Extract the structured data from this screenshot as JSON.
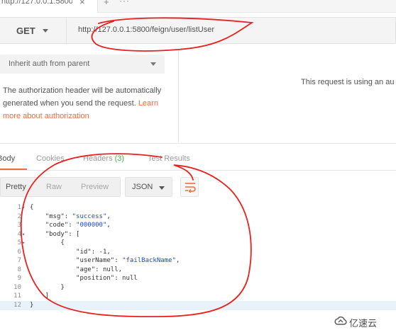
{
  "tab": {
    "title": "http://127.0.0.1:5800/",
    "close": "×",
    "add": "+",
    "more": "···"
  },
  "request": {
    "method": "GET",
    "url": "http://127.0.0.1:5800/feign/user/listUser"
  },
  "auth": {
    "type_selected": "Inherit auth from parent",
    "description": "The authorization header will be automatically generated when you send the request.",
    "link_text": "Learn more about authorization",
    "note": "This request is using an au"
  },
  "response_tabs": [
    {
      "label": "Body",
      "active": true
    },
    {
      "label": "Cookies"
    },
    {
      "label": "Headers",
      "count": "(3)"
    },
    {
      "label": "Test Results"
    }
  ],
  "body_toolbar": {
    "pretty": "Pretty",
    "raw": "Raw",
    "preview": "Preview",
    "language": "JSON"
  },
  "code_lines": [
    {
      "n": "1",
      "fold": true,
      "parts": [
        [
          "p",
          "{"
        ]
      ]
    },
    {
      "n": "2",
      "parts": [
        [
          "p",
          "    "
        ],
        [
          "k",
          "\"msg\""
        ],
        [
          "p",
          ": "
        ],
        [
          "s",
          "\"success\""
        ],
        [
          "p",
          ","
        ]
      ]
    },
    {
      "n": "3",
      "parts": [
        [
          "p",
          "    "
        ],
        [
          "k",
          "\"code\""
        ],
        [
          "p",
          ": "
        ],
        [
          "s",
          "\"000000\""
        ],
        [
          "p",
          ","
        ]
      ]
    },
    {
      "n": "4",
      "fold": true,
      "parts": [
        [
          "p",
          "    "
        ],
        [
          "k",
          "\"body\""
        ],
        [
          "p",
          ": ["
        ]
      ]
    },
    {
      "n": "5",
      "fold": true,
      "parts": [
        [
          "p",
          "        {"
        ]
      ]
    },
    {
      "n": "6",
      "parts": [
        [
          "p",
          "            "
        ],
        [
          "k",
          "\"id\""
        ],
        [
          "p",
          ": -1,"
        ]
      ]
    },
    {
      "n": "7",
      "parts": [
        [
          "p",
          "            "
        ],
        [
          "k",
          "\"userName\""
        ],
        [
          "p",
          ": "
        ],
        [
          "s",
          "\"failBackName\""
        ],
        [
          "p",
          ","
        ]
      ]
    },
    {
      "n": "8",
      "parts": [
        [
          "p",
          "            "
        ],
        [
          "k",
          "\"age\""
        ],
        [
          "p",
          ": null,"
        ]
      ]
    },
    {
      "n": "9",
      "parts": [
        [
          "p",
          "            "
        ],
        [
          "k",
          "\"position\""
        ],
        [
          "p",
          ": null"
        ]
      ]
    },
    {
      "n": "10",
      "parts": [
        [
          "p",
          "        }"
        ]
      ]
    },
    {
      "n": "11",
      "parts": [
        [
          "p",
          "    ]"
        ]
      ]
    },
    {
      "n": "12",
      "hl": true,
      "parts": [
        [
          "p",
          "}"
        ]
      ]
    }
  ],
  "watermark": {
    "text": "亿速云"
  },
  "colors": {
    "accent": "#f26b3a",
    "annotation": "#e8201e",
    "string": "#1a4bcf",
    "headers_count": "#4caf50"
  },
  "icons": [
    "tab-close-icon",
    "new-tab-icon",
    "more-icon",
    "chevron-down-icon",
    "wrap-lines-icon",
    "fold-arrow-icon",
    "cloud-logo-icon"
  ]
}
